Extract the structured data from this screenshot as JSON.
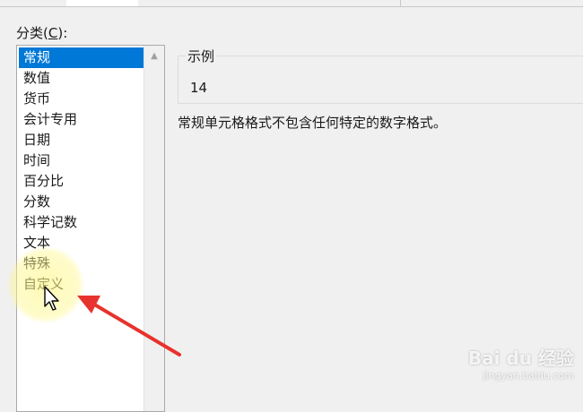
{
  "category_label": "分类(",
  "category_hotkey": "C",
  "category_label_end": "):",
  "categories": [
    {
      "label": "常规",
      "selected": true
    },
    {
      "label": "数值"
    },
    {
      "label": "货币"
    },
    {
      "label": "会计专用"
    },
    {
      "label": "日期"
    },
    {
      "label": "时间"
    },
    {
      "label": "百分比"
    },
    {
      "label": "分数"
    },
    {
      "label": "科学记数"
    },
    {
      "label": "文本"
    },
    {
      "label": "特殊"
    },
    {
      "label": "自定义"
    }
  ],
  "sample": {
    "legend": "示例",
    "value": "14"
  },
  "description": "常规单元格格式不包含任何特定的数字格式。",
  "watermark": {
    "logo": "Bai du 经验",
    "sub": "jingyan.baidu.com"
  },
  "colors": {
    "selection": "#0078d7",
    "arrow": "#e8322d",
    "highlight": "#fff78c"
  },
  "icons": {
    "scroll_up": "chevron-up-icon",
    "cursor": "mouse-pointer-icon",
    "annotation": "red-arrow-icon"
  }
}
